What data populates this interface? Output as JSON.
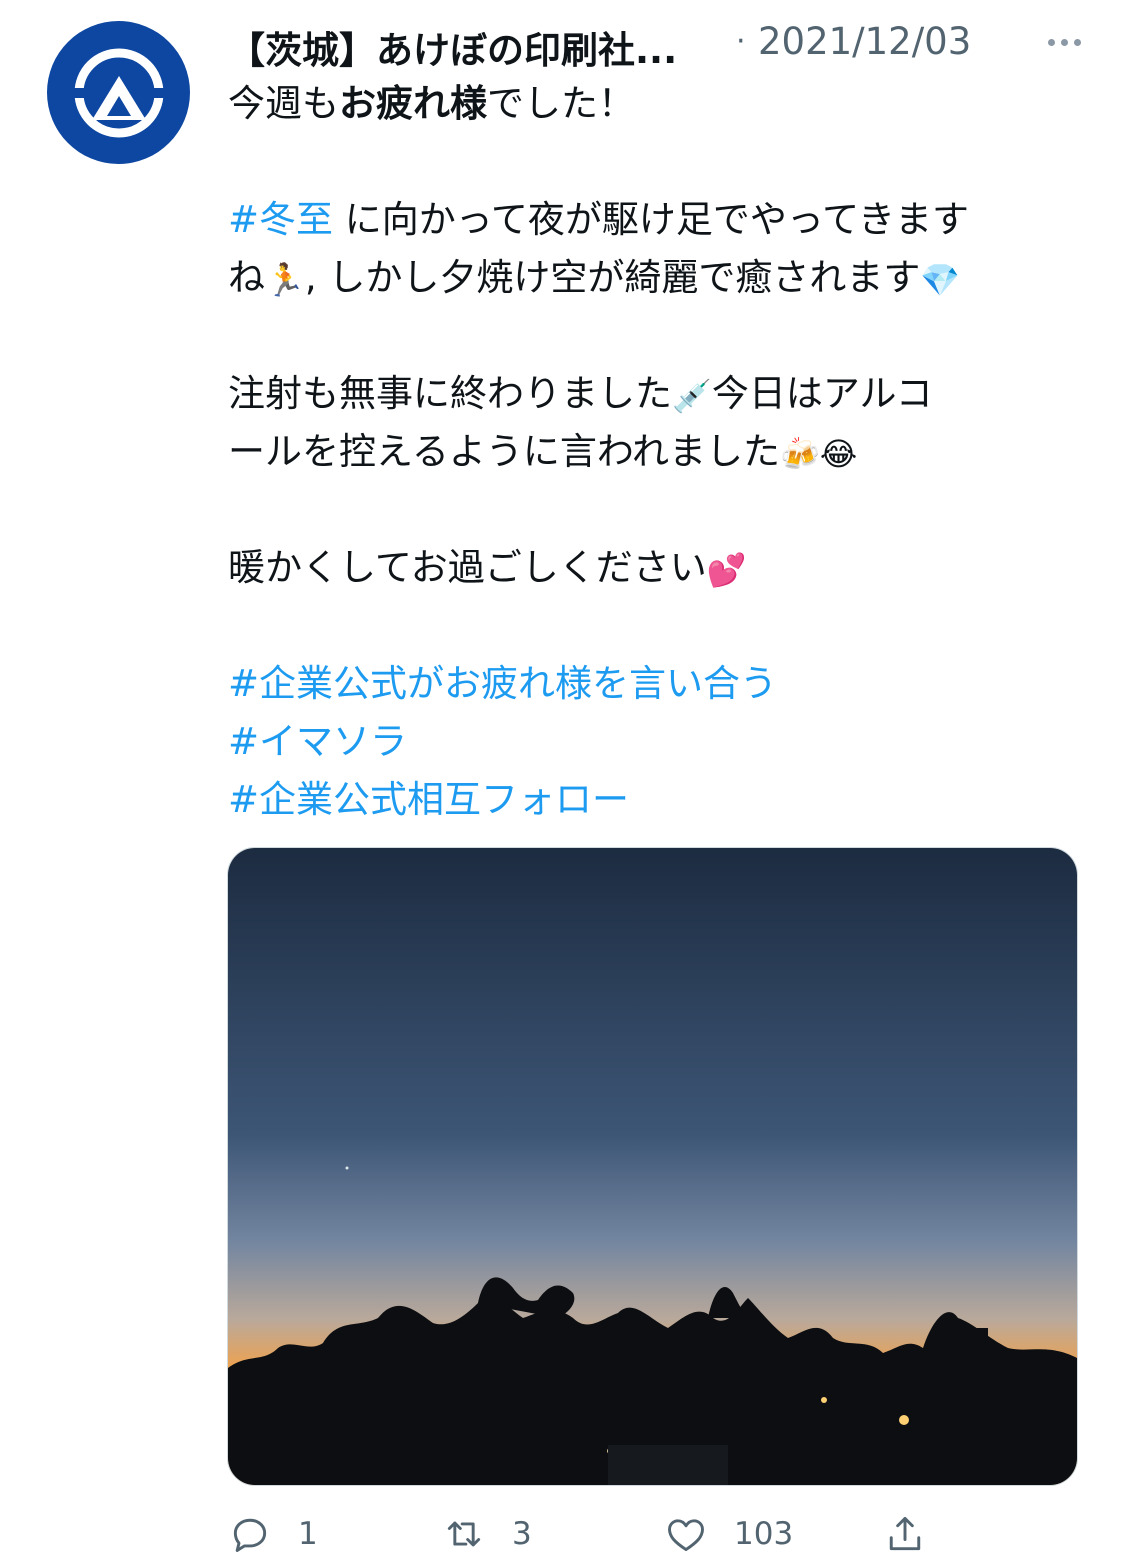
{
  "tweet": {
    "author_name": "【茨城】あけぼの印刷社...",
    "separator": "·",
    "date": "2021/12/03",
    "more_icon": "more-horizontal-icon",
    "lines": {
      "l1_pre": "今週も",
      "l1_bold": "お疲れ様",
      "l1_post": "でした！",
      "l2_hashtag": "#冬至",
      "l2_text": " に向かって夜が駆け足でやってきます",
      "l3_pre": "ね",
      "l3_emoji": "🏃",
      "l3_text": ", しかし夕焼け空が綺麗で癒されます",
      "l3_emoji2": "💎",
      "l4_text": "注射も無事に終わりました",
      "l4_emoji": "💉",
      "l4_text2": "今日はアルコ",
      "l5_text": "ールを控えるように言われました",
      "l5_emoji": "🍻",
      "l5_emoji2": "😂",
      "l6_text": "暖かくしてお過ごしください",
      "l6_emoji": "💕",
      "hashtag1": "#企業公式がお疲れ様を言い合う",
      "hashtag2": "#イマソラ",
      "hashtag3": "#企業公式相互フォロー"
    }
  },
  "photo": {
    "subject": "dusk-sky-over-treeline",
    "colors": {
      "sky_top": "#1f2f45",
      "sky_mid": "#4a6487",
      "horizon": "#f2a24a",
      "trees": "#0d0f12"
    }
  },
  "actions": {
    "reply": {
      "icon": "reply-icon",
      "count": "1"
    },
    "retweet": {
      "icon": "retweet-icon",
      "count": "3"
    },
    "like": {
      "icon": "heart-icon",
      "count": "103"
    },
    "share": {
      "icon": "share-icon"
    }
  },
  "colors": {
    "link": "#1d9bf0",
    "muted": "#536471",
    "avatar_bg": "#0d47a1"
  }
}
